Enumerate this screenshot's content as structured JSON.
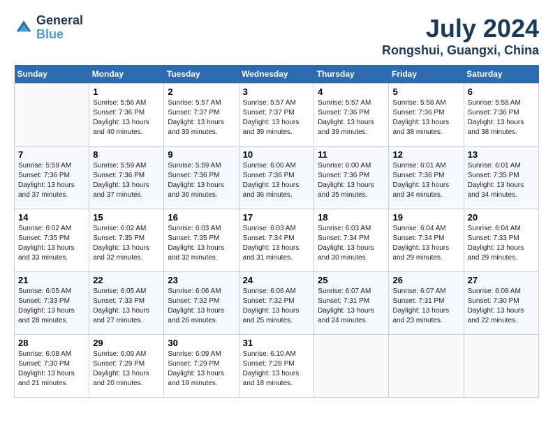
{
  "header": {
    "logo_line1": "General",
    "logo_line2": "Blue",
    "month_title": "July 2024",
    "location": "Rongshui, Guangxi, China"
  },
  "weekdays": [
    "Sunday",
    "Monday",
    "Tuesday",
    "Wednesday",
    "Thursday",
    "Friday",
    "Saturday"
  ],
  "weeks": [
    [
      {
        "day": "",
        "sunrise": "",
        "sunset": "",
        "daylight": ""
      },
      {
        "day": "1",
        "sunrise": "Sunrise: 5:56 AM",
        "sunset": "Sunset: 7:36 PM",
        "daylight": "Daylight: 13 hours and 40 minutes."
      },
      {
        "day": "2",
        "sunrise": "Sunrise: 5:57 AM",
        "sunset": "Sunset: 7:37 PM",
        "daylight": "Daylight: 13 hours and 39 minutes."
      },
      {
        "day": "3",
        "sunrise": "Sunrise: 5:57 AM",
        "sunset": "Sunset: 7:37 PM",
        "daylight": "Daylight: 13 hours and 39 minutes."
      },
      {
        "day": "4",
        "sunrise": "Sunrise: 5:57 AM",
        "sunset": "Sunset: 7:36 PM",
        "daylight": "Daylight: 13 hours and 39 minutes."
      },
      {
        "day": "5",
        "sunrise": "Sunrise: 5:58 AM",
        "sunset": "Sunset: 7:36 PM",
        "daylight": "Daylight: 13 hours and 38 minutes."
      },
      {
        "day": "6",
        "sunrise": "Sunrise: 5:58 AM",
        "sunset": "Sunset: 7:36 PM",
        "daylight": "Daylight: 13 hours and 38 minutes."
      }
    ],
    [
      {
        "day": "7",
        "sunrise": "Sunrise: 5:59 AM",
        "sunset": "Sunset: 7:36 PM",
        "daylight": "Daylight: 13 hours and 37 minutes."
      },
      {
        "day": "8",
        "sunrise": "Sunrise: 5:59 AM",
        "sunset": "Sunset: 7:36 PM",
        "daylight": "Daylight: 13 hours and 37 minutes."
      },
      {
        "day": "9",
        "sunrise": "Sunrise: 5:59 AM",
        "sunset": "Sunset: 7:36 PM",
        "daylight": "Daylight: 13 hours and 36 minutes."
      },
      {
        "day": "10",
        "sunrise": "Sunrise: 6:00 AM",
        "sunset": "Sunset: 7:36 PM",
        "daylight": "Daylight: 13 hours and 36 minutes."
      },
      {
        "day": "11",
        "sunrise": "Sunrise: 6:00 AM",
        "sunset": "Sunset: 7:36 PM",
        "daylight": "Daylight: 13 hours and 35 minutes."
      },
      {
        "day": "12",
        "sunrise": "Sunrise: 6:01 AM",
        "sunset": "Sunset: 7:36 PM",
        "daylight": "Daylight: 13 hours and 34 minutes."
      },
      {
        "day": "13",
        "sunrise": "Sunrise: 6:01 AM",
        "sunset": "Sunset: 7:35 PM",
        "daylight": "Daylight: 13 hours and 34 minutes."
      }
    ],
    [
      {
        "day": "14",
        "sunrise": "Sunrise: 6:02 AM",
        "sunset": "Sunset: 7:35 PM",
        "daylight": "Daylight: 13 hours and 33 minutes."
      },
      {
        "day": "15",
        "sunrise": "Sunrise: 6:02 AM",
        "sunset": "Sunset: 7:35 PM",
        "daylight": "Daylight: 13 hours and 32 minutes."
      },
      {
        "day": "16",
        "sunrise": "Sunrise: 6:03 AM",
        "sunset": "Sunset: 7:35 PM",
        "daylight": "Daylight: 13 hours and 32 minutes."
      },
      {
        "day": "17",
        "sunrise": "Sunrise: 6:03 AM",
        "sunset": "Sunset: 7:34 PM",
        "daylight": "Daylight: 13 hours and 31 minutes."
      },
      {
        "day": "18",
        "sunrise": "Sunrise: 6:03 AM",
        "sunset": "Sunset: 7:34 PM",
        "daylight": "Daylight: 13 hours and 30 minutes."
      },
      {
        "day": "19",
        "sunrise": "Sunrise: 6:04 AM",
        "sunset": "Sunset: 7:34 PM",
        "daylight": "Daylight: 13 hours and 29 minutes."
      },
      {
        "day": "20",
        "sunrise": "Sunrise: 6:04 AM",
        "sunset": "Sunset: 7:33 PM",
        "daylight": "Daylight: 13 hours and 29 minutes."
      }
    ],
    [
      {
        "day": "21",
        "sunrise": "Sunrise: 6:05 AM",
        "sunset": "Sunset: 7:33 PM",
        "daylight": "Daylight: 13 hours and 28 minutes."
      },
      {
        "day": "22",
        "sunrise": "Sunrise: 6:05 AM",
        "sunset": "Sunset: 7:33 PM",
        "daylight": "Daylight: 13 hours and 27 minutes."
      },
      {
        "day": "23",
        "sunrise": "Sunrise: 6:06 AM",
        "sunset": "Sunset: 7:32 PM",
        "daylight": "Daylight: 13 hours and 26 minutes."
      },
      {
        "day": "24",
        "sunrise": "Sunrise: 6:06 AM",
        "sunset": "Sunset: 7:32 PM",
        "daylight": "Daylight: 13 hours and 25 minutes."
      },
      {
        "day": "25",
        "sunrise": "Sunrise: 6:07 AM",
        "sunset": "Sunset: 7:31 PM",
        "daylight": "Daylight: 13 hours and 24 minutes."
      },
      {
        "day": "26",
        "sunrise": "Sunrise: 6:07 AM",
        "sunset": "Sunset: 7:31 PM",
        "daylight": "Daylight: 13 hours and 23 minutes."
      },
      {
        "day": "27",
        "sunrise": "Sunrise: 6:08 AM",
        "sunset": "Sunset: 7:30 PM",
        "daylight": "Daylight: 13 hours and 22 minutes."
      }
    ],
    [
      {
        "day": "28",
        "sunrise": "Sunrise: 6:08 AM",
        "sunset": "Sunset: 7:30 PM",
        "daylight": "Daylight: 13 hours and 21 minutes."
      },
      {
        "day": "29",
        "sunrise": "Sunrise: 6:09 AM",
        "sunset": "Sunset: 7:29 PM",
        "daylight": "Daylight: 13 hours and 20 minutes."
      },
      {
        "day": "30",
        "sunrise": "Sunrise: 6:09 AM",
        "sunset": "Sunset: 7:29 PM",
        "daylight": "Daylight: 13 hours and 19 minutes."
      },
      {
        "day": "31",
        "sunrise": "Sunrise: 6:10 AM",
        "sunset": "Sunset: 7:28 PM",
        "daylight": "Daylight: 13 hours and 18 minutes."
      },
      {
        "day": "",
        "sunrise": "",
        "sunset": "",
        "daylight": ""
      },
      {
        "day": "",
        "sunrise": "",
        "sunset": "",
        "daylight": ""
      },
      {
        "day": "",
        "sunrise": "",
        "sunset": "",
        "daylight": ""
      }
    ]
  ]
}
